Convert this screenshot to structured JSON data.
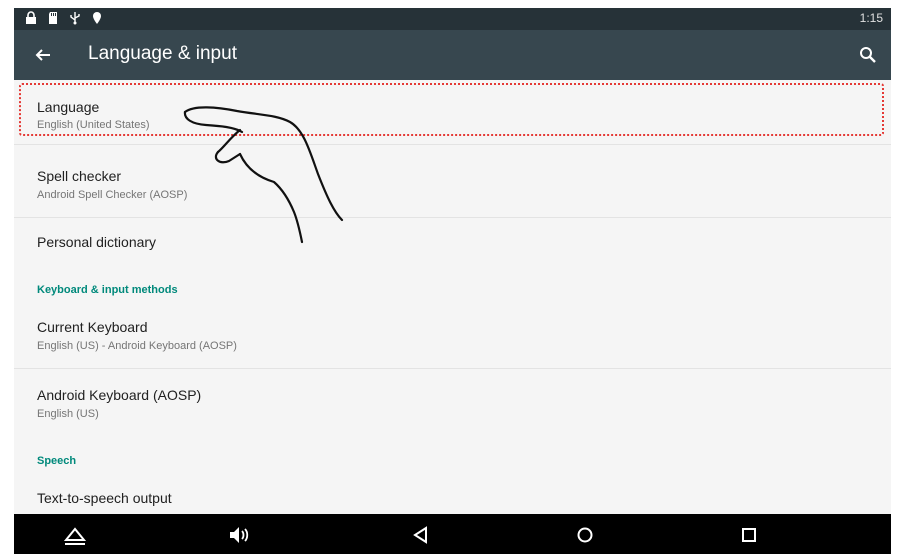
{
  "status_bar": {
    "time": "1:15",
    "icons": [
      "lock-icon",
      "sd-card-icon",
      "usb-icon",
      "location-pin-icon"
    ]
  },
  "app_bar": {
    "title": "Language & input",
    "back_icon": "arrow-back-icon",
    "search_icon": "search-icon"
  },
  "settings": {
    "language": {
      "title": "Language",
      "summary": "English (United States)"
    },
    "spell_checker": {
      "title": "Spell checker",
      "summary": "Android Spell Checker (AOSP)"
    },
    "personal_dictionary": {
      "title": "Personal dictionary"
    },
    "keyboard_section": "Keyboard & input methods",
    "current_keyboard": {
      "title": "Current Keyboard",
      "summary": "English (US) - Android Keyboard (AOSP)"
    },
    "android_keyboard": {
      "title": "Android Keyboard (AOSP)",
      "summary": "English (US)"
    },
    "speech_section": "Speech",
    "tts": {
      "title": "Text-to-speech output"
    }
  },
  "nav_bar": {
    "icons": [
      "home-triangle-icon",
      "volume-icon",
      "back-triangle-icon",
      "home-circle-icon",
      "recents-square-icon"
    ]
  },
  "colors": {
    "status_bar": "#263238",
    "app_bar": "#37474f",
    "section_header": "#00897b",
    "highlight": "#e53935"
  }
}
